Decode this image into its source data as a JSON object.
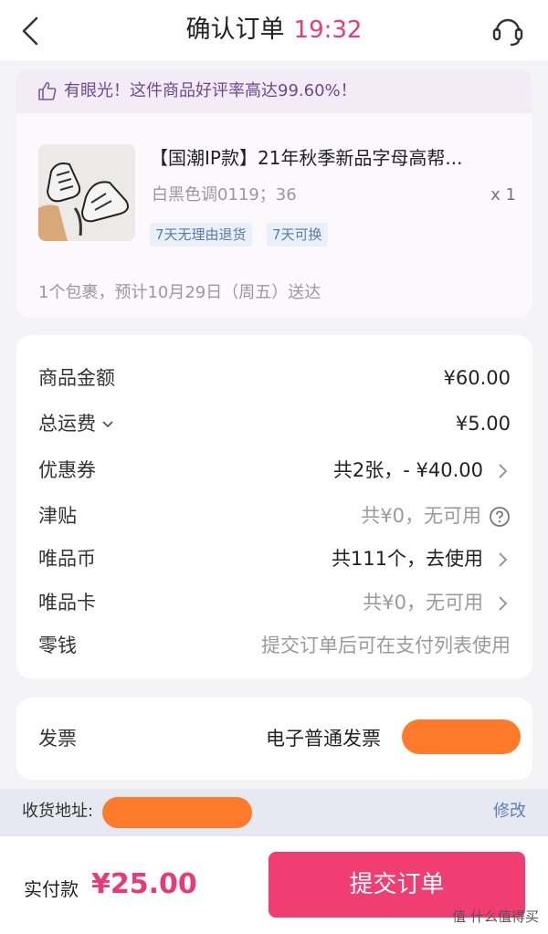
{
  "header": {
    "title": "确认订单",
    "time": "19:32"
  },
  "tip": {
    "text": "有眼光！这件商品好评率高达99.60%！"
  },
  "goods": {
    "title": "【国潮IP款】21年秋季新品字母高帮...",
    "spec": "白黑色调0119；36",
    "qty": "x 1",
    "tags": [
      "7天无理由退货",
      "7天可换"
    ],
    "delivery": "1个包裹，预计10月29日（周五）送达"
  },
  "price_rows": [
    {
      "label": "商品金额",
      "value": "¥60.00"
    },
    {
      "label": "总运费",
      "value": "¥5.00"
    },
    {
      "label": "优惠券",
      "value": "共2张，- ¥40.00"
    },
    {
      "label": "津贴",
      "value": "共¥0，无可用"
    },
    {
      "label": "唯品币",
      "value": "共111个，去使用"
    },
    {
      "label": "唯品卡",
      "value": "共¥0，无可用"
    },
    {
      "label": "零钱",
      "value": "提交订单后可在支付列表使用"
    }
  ],
  "invoice": {
    "label": "发票",
    "value": "电子普通发票"
  },
  "address": {
    "label": "收货地址:",
    "edit": "修改"
  },
  "footer": {
    "pay_label": "实付款",
    "amount": "¥25.00",
    "submit": "提交订单",
    "watermark": "值 什么值得买"
  },
  "colors": {
    "accent": "#e83a78",
    "submit_bg": "#f03d72",
    "link": "#5b7fb8",
    "redaction": "#ff7a2b"
  }
}
